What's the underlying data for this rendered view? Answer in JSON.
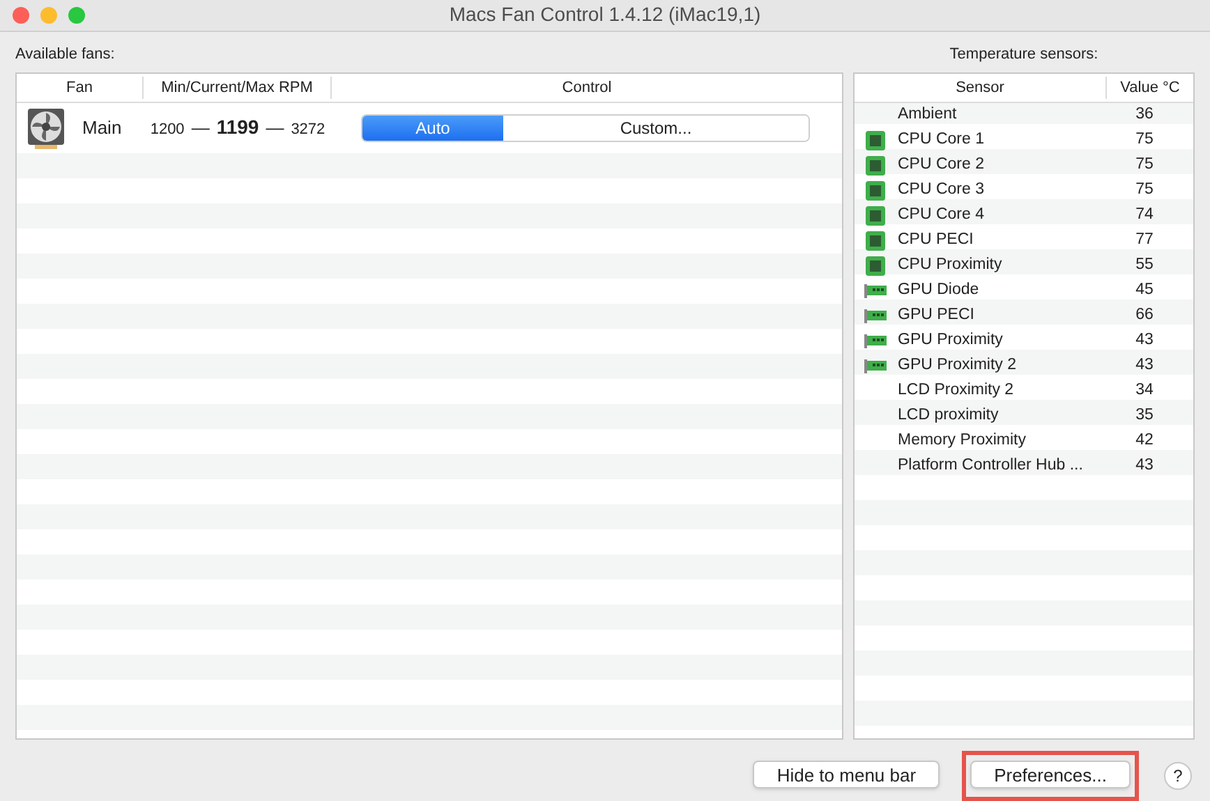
{
  "window": {
    "title": "Macs Fan Control 1.4.12 (iMac19,1)"
  },
  "fans": {
    "label": "Available fans:",
    "columns": [
      "Fan",
      "Min/Current/Max RPM",
      "Control"
    ],
    "rows": [
      {
        "name": "Main",
        "min": "1200",
        "current": "1199",
        "max": "3272",
        "separator": "—",
        "controls": [
          {
            "label": "Auto",
            "selected": true
          },
          {
            "label": "Custom...",
            "selected": false
          }
        ]
      }
    ]
  },
  "sensors": {
    "label": "Temperature sensors:",
    "columns": [
      "Sensor",
      "Value °C"
    ],
    "rows": [
      {
        "name": "Ambient",
        "value": "36",
        "kind": "none"
      },
      {
        "name": "CPU Core 1",
        "value": "75",
        "kind": "cpu"
      },
      {
        "name": "CPU Core 2",
        "value": "75",
        "kind": "cpu"
      },
      {
        "name": "CPU Core 3",
        "value": "75",
        "kind": "cpu"
      },
      {
        "name": "CPU Core 4",
        "value": "74",
        "kind": "cpu"
      },
      {
        "name": "CPU PECI",
        "value": "77",
        "kind": "cpu"
      },
      {
        "name": "CPU Proximity",
        "value": "55",
        "kind": "cpu"
      },
      {
        "name": "GPU Diode",
        "value": "45",
        "kind": "gpu"
      },
      {
        "name": "GPU PECI",
        "value": "66",
        "kind": "gpu"
      },
      {
        "name": "GPU Proximity",
        "value": "43",
        "kind": "gpu"
      },
      {
        "name": "GPU Proximity 2",
        "value": "43",
        "kind": "gpu"
      },
      {
        "name": "LCD Proximity 2",
        "value": "34",
        "kind": "none"
      },
      {
        "name": "LCD proximity",
        "value": "35",
        "kind": "none"
      },
      {
        "name": "Memory Proximity",
        "value": "42",
        "kind": "none"
      },
      {
        "name": "Platform Controller Hub ...",
        "value": "43",
        "kind": "none"
      }
    ]
  },
  "buttons": [
    {
      "label": "Hide to menu bar",
      "highlighted": false
    },
    {
      "label": "Preferences...",
      "highlighted": true
    }
  ],
  "help": "?"
}
